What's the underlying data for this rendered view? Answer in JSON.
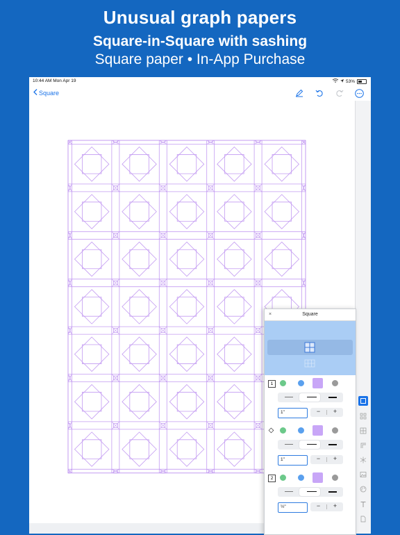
{
  "promo": {
    "headline": "Unusual graph papers",
    "subheadline": "Square-in-Square with sashing",
    "caption": "Square paper • In-App Purchase"
  },
  "statusbar": {
    "time": "10:44 AM  Mon Apr 19",
    "battery": "53%"
  },
  "navbar": {
    "back_label": "Square",
    "icons": [
      "pen-icon",
      "undo-icon",
      "redo-icon",
      "more-icon"
    ]
  },
  "panel": {
    "close_label": "×",
    "title": "Square",
    "sections": [
      {
        "badge": "1",
        "width_value": "1\""
      },
      {
        "badge": "◇",
        "width_value": "1\""
      },
      {
        "badge": "2",
        "width_value": "½\""
      }
    ],
    "stepper_minus": "−",
    "stepper_plus": "+"
  },
  "colors": {
    "promo_bg": "#1467c0",
    "grid_line": "#c39bf2",
    "green": "#6cc98a",
    "blue": "#5aa0ee",
    "purple": "#c8a6f7",
    "gray": "#9a9a9a",
    "accent": "#1a73e8"
  },
  "sidebar_icons": [
    "square-tool-icon",
    "grid-tool-icon",
    "table-tool-icon",
    "corner-tool-icon",
    "snowflake-tool-icon",
    "image-tool-icon",
    "palette-tool-icon",
    "text-tool-icon",
    "document-tool-icon"
  ]
}
